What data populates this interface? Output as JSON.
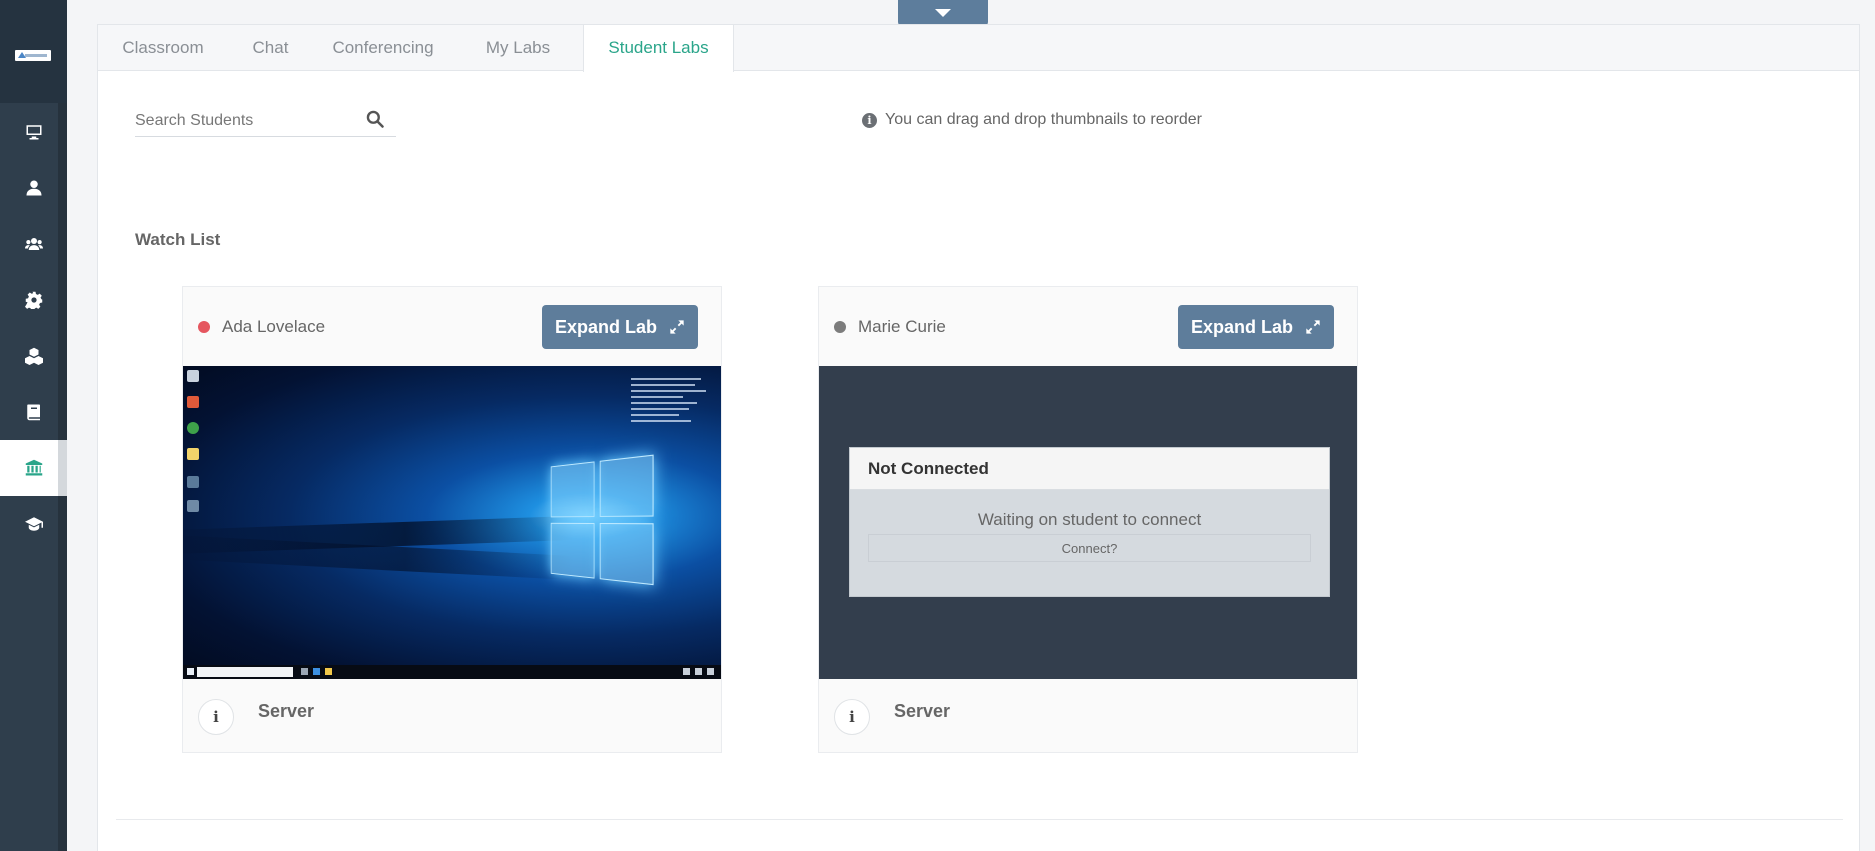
{
  "top_toggle": {
    "icon": "caret-down-icon"
  },
  "sidebar": {
    "logo": "company-logo",
    "items": [
      {
        "name": "monitor",
        "icon": "monitor-icon"
      },
      {
        "name": "user",
        "icon": "user-icon"
      },
      {
        "name": "users",
        "icon": "users-icon"
      },
      {
        "name": "settings",
        "icon": "gear-icon"
      },
      {
        "name": "labs",
        "icon": "cubes-icon"
      },
      {
        "name": "book",
        "icon": "book-icon"
      },
      {
        "name": "institution",
        "icon": "institution-icon",
        "active": true
      },
      {
        "name": "courses",
        "icon": "graduation-cap-icon"
      }
    ]
  },
  "tabs": [
    {
      "label": "Classroom"
    },
    {
      "label": "Chat"
    },
    {
      "label": "Conferencing"
    },
    {
      "label": "My Labs"
    },
    {
      "label": "Student Labs",
      "active": true
    }
  ],
  "search": {
    "placeholder": "Search Students",
    "value": ""
  },
  "hint": "You can drag and drop thumbnails to reorder",
  "watch_list": {
    "title": "Watch List",
    "cards": [
      {
        "student": "Ada Lovelace",
        "status": "online",
        "status_color": "#e5565f",
        "expand_label": "Expand Lab",
        "screen": "windows-desktop",
        "footer_label": "Server"
      },
      {
        "student": "Marie Curie",
        "status": "offline",
        "status_color": "#7c7c7c",
        "expand_label": "Expand Lab",
        "screen": "not-connected",
        "not_connected": {
          "title": "Not Connected",
          "message": "Waiting on student to connect",
          "button": "Connect?"
        },
        "footer_label": "Server"
      }
    ]
  },
  "colors": {
    "accent": "#2aa58a",
    "sidebar": "#2f3e4c",
    "button": "#5e7d9b"
  }
}
